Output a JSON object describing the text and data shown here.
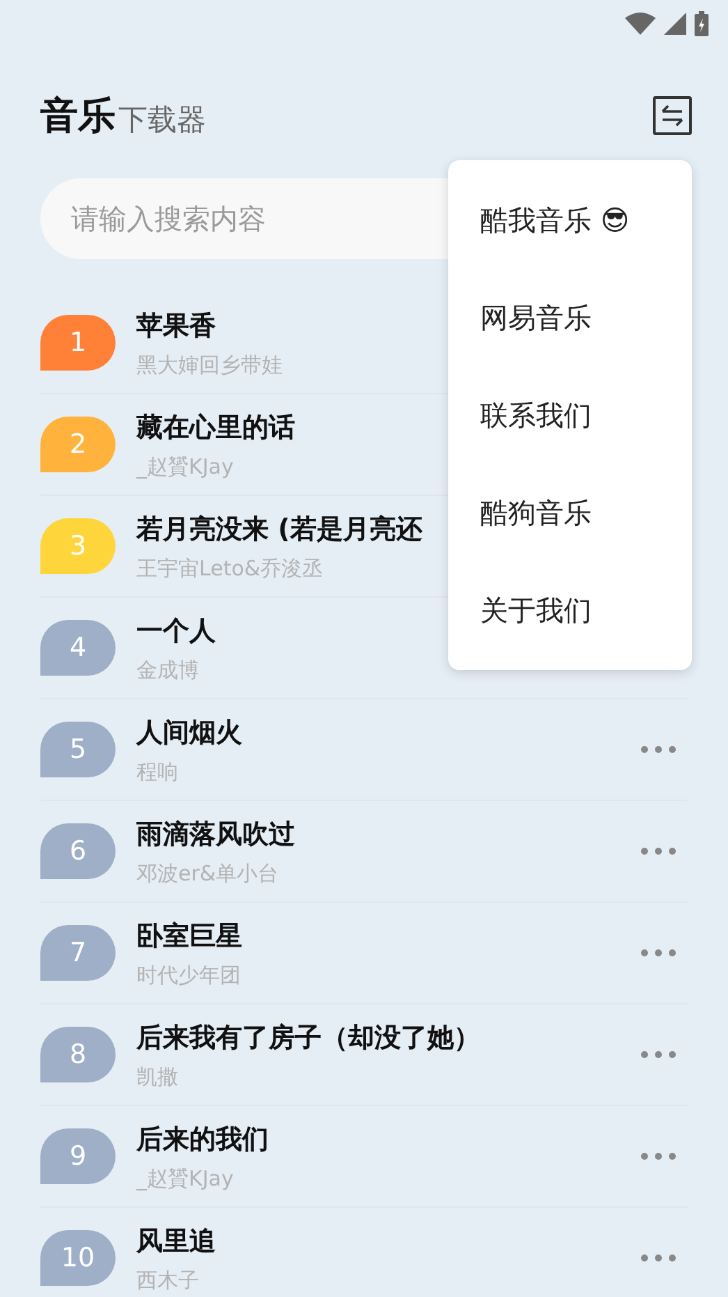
{
  "header": {
    "title": "音乐",
    "subtitle": "下载器"
  },
  "search": {
    "placeholder": "请输入搜索内容"
  },
  "songs": [
    {
      "rank": "1",
      "title": "苹果香",
      "artist": "黑大婶回乡带娃",
      "color": "#ff8137"
    },
    {
      "rank": "2",
      "title": "藏在心里的话",
      "artist": "_赵贇KJay",
      "color": "#ffb33c"
    },
    {
      "rank": "3",
      "title": "若月亮没来 (若是月亮还",
      "artist": "王宇宙Leto&乔浚丞",
      "color": "#ffd53c"
    },
    {
      "rank": "4",
      "title": "一个人",
      "artist": "金成博",
      "color": "#9eafc7"
    },
    {
      "rank": "5",
      "title": "人间烟火",
      "artist": "程响",
      "color": "#9eafc7"
    },
    {
      "rank": "6",
      "title": "雨滴落风吹过",
      "artist": "邓波er&单小台",
      "color": "#9eafc7"
    },
    {
      "rank": "7",
      "title": "卧室巨星",
      "artist": "时代少年团",
      "color": "#9eafc7"
    },
    {
      "rank": "8",
      "title": "后来我有了房子（却没了她）",
      "artist": "凯撒",
      "color": "#9eafc7"
    },
    {
      "rank": "9",
      "title": "后来的我们",
      "artist": "_赵贇KJay",
      "color": "#9eafc7"
    },
    {
      "rank": "10",
      "title": "风里追",
      "artist": "西木子",
      "color": "#9eafc7"
    }
  ],
  "menu": {
    "items": [
      "酷我音乐 😎",
      "网易音乐",
      "联系我们",
      "酷狗音乐",
      "关于我们"
    ]
  }
}
